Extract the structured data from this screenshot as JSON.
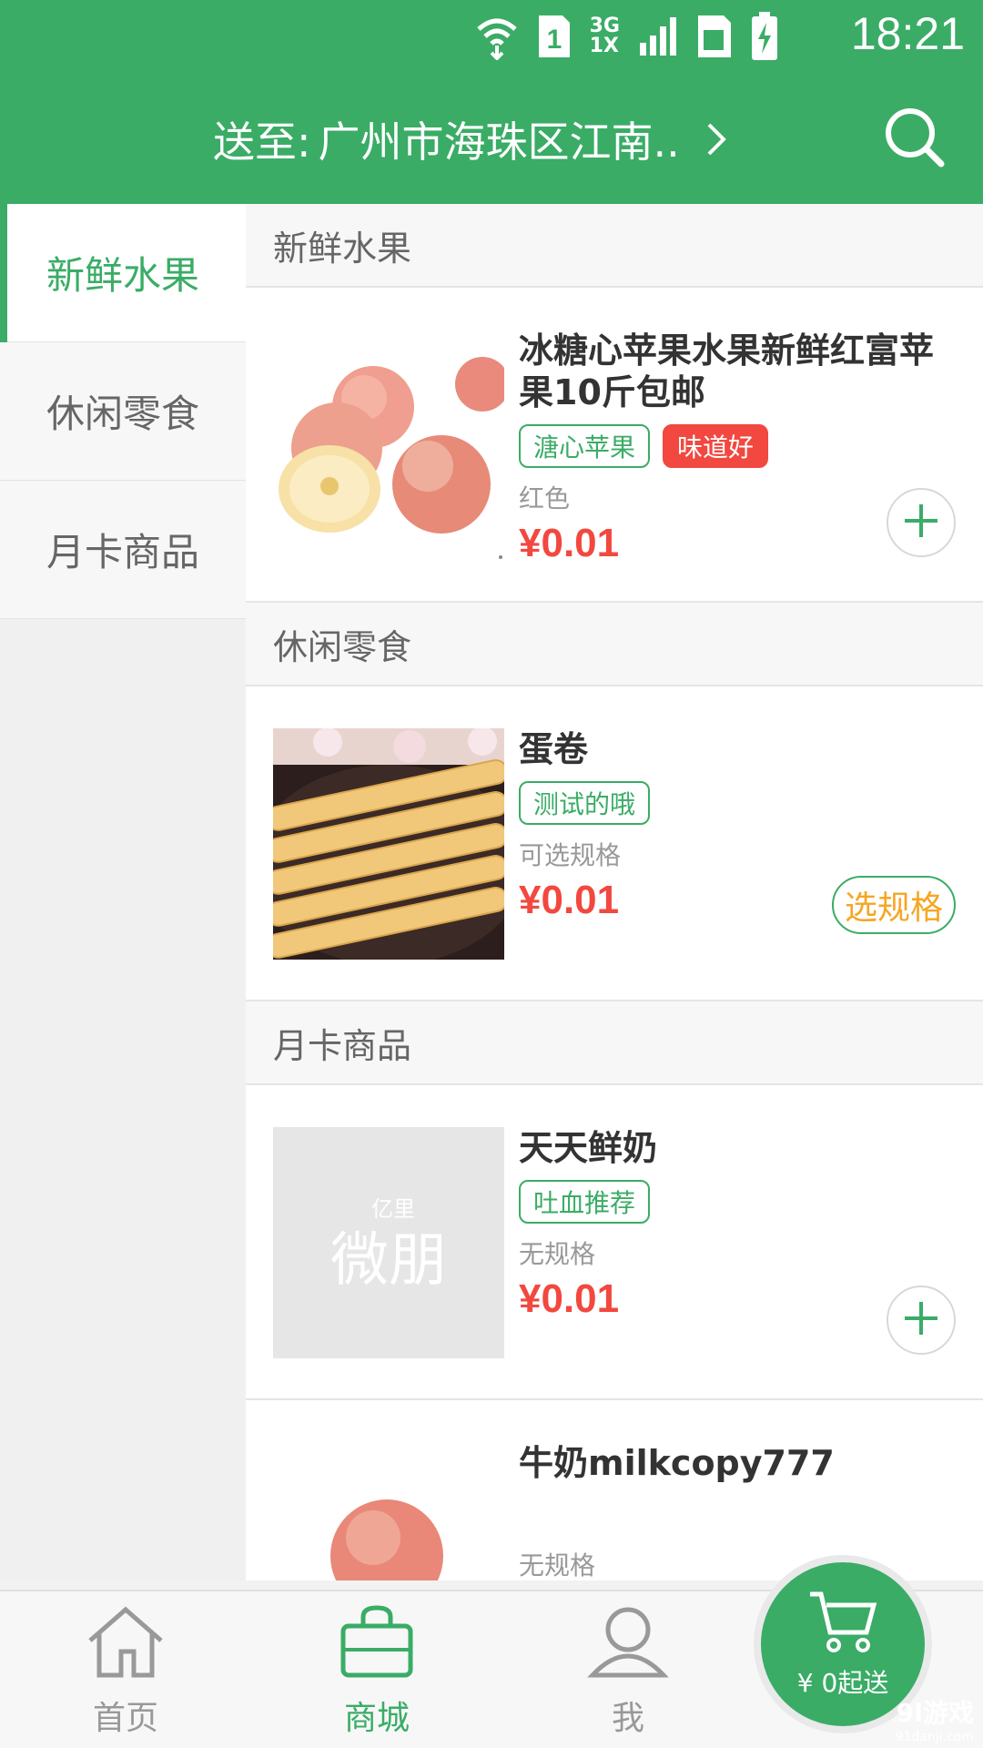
{
  "status": {
    "time": "18:21",
    "sim": "1",
    "net_top": "3G",
    "net_bottom": "1X"
  },
  "header": {
    "address_label": "送至:",
    "address": "广州市海珠区江南..",
    "icons": [
      "chevron-right-icon",
      "search-icon"
    ]
  },
  "sidebar": {
    "items": [
      {
        "label": "新鲜水果",
        "active": true
      },
      {
        "label": "休闲零食",
        "active": false
      },
      {
        "label": "月卡商品",
        "active": false
      }
    ]
  },
  "sections": [
    {
      "title": "新鲜水果",
      "items": [
        {
          "name": "冰糖心苹果水果新鲜红富苹果10斤包邮",
          "tags": [
            {
              "text": "溏心苹果",
              "style": "outline"
            },
            {
              "text": "味道好",
              "style": "filled-red"
            }
          ],
          "spec": "红色",
          "price": "¥0.01",
          "action": "add",
          "image": "apples"
        }
      ]
    },
    {
      "title": "休闲零食",
      "items": [
        {
          "name": "蛋卷",
          "tags": [
            {
              "text": "测试的哦",
              "style": "outline"
            }
          ],
          "spec": "可选规格",
          "price": "¥0.01",
          "action": "choose",
          "action_label": "选规格",
          "image": "egg-rolls"
        }
      ]
    },
    {
      "title": "月卡商品",
      "items": [
        {
          "name": "天天鲜奶",
          "tags": [
            {
              "text": "吐血推荐",
              "style": "outline"
            }
          ],
          "spec": "无规格",
          "price": "¥0.01",
          "action": "add",
          "image": "placeholder-logo",
          "image_text_top": "亿里",
          "image_text": "微朋"
        },
        {
          "name": "牛奶milkcopy777",
          "spec": "无规格",
          "image": "apple"
        }
      ]
    }
  ],
  "bottom_nav": {
    "tabs": [
      {
        "label": "首页",
        "icon": "home-icon",
        "active": false
      },
      {
        "label": "商城",
        "icon": "shopping-bag-icon",
        "active": true
      },
      {
        "label": "我",
        "icon": "user-icon",
        "active": false
      }
    ],
    "cart": {
      "amount_text": "¥ 0起送",
      "icon": "cart-icon"
    }
  },
  "watermark": {
    "brand": "9l游戏",
    "site": "91danji.com"
  },
  "colors": {
    "primary": "#3aac66",
    "price": "#f2483f",
    "choose_text": "#f5a623"
  }
}
